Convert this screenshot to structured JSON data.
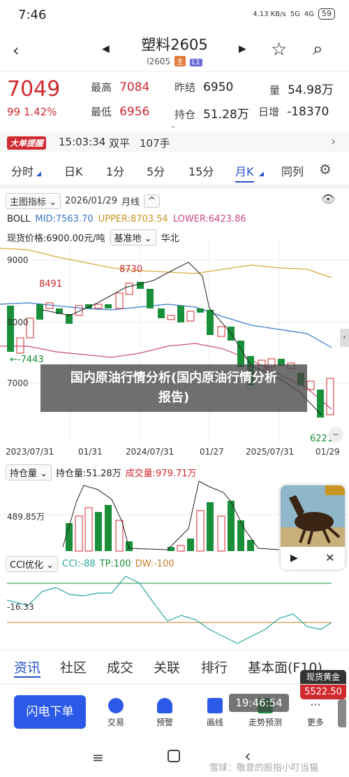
{
  "status": {
    "time": "7:46",
    "speed": "4.13 KB/s",
    "network": "5G",
    "network2": "4G",
    "battery": "59"
  },
  "header": {
    "title": "塑料2605",
    "code": "l2605",
    "tag_main": "主",
    "tag_l1": "L1"
  },
  "quote": {
    "price": "7049",
    "change": "99",
    "change_pct": "1.42%",
    "high_label": "最高",
    "high": "7084",
    "low_label": "最低",
    "low": "6956",
    "prev_label": "昨结",
    "prev": "6950",
    "oi_label": "持仓",
    "oi": "51.28万",
    "vol_label": "量",
    "vol": "54.98万",
    "daily_label": "日增",
    "daily": "-18370"
  },
  "ticker": {
    "badge": "大单提醒",
    "time": "15:03:34",
    "type": "双平",
    "qty": "107手"
  },
  "tabs": [
    "分时",
    "日K",
    "1分",
    "5分",
    "15分",
    "月K",
    "同列"
  ],
  "indicator": {
    "main_label": "主图指标",
    "date": "2026/01/29",
    "period": "月线"
  },
  "boll": {
    "name": "BOLL",
    "mid": "MID:7563.70",
    "upper": "UPPER:8703.54",
    "lower": "LOWER:6423.86"
  },
  "spot": {
    "label": "现货价格:6900.00元/吨",
    "basis": "基准地",
    "region": "华北"
  },
  "axis": {
    "y1": "9000",
    "y2": "8000",
    "y3": "7000",
    "mark_high": "8730",
    "mark_8491": "8491",
    "mark_7443": "7443",
    "mark_low": "6221"
  },
  "dates": [
    "2023/07/31",
    "01/31",
    "2024/07/31",
    "01/27",
    "2025/07/31",
    "01/29"
  ],
  "oi_panel": {
    "label": "持仓量",
    "oi": "持仓量:51.28万",
    "vol": "成交量:979.71万",
    "axis": "489.85万"
  },
  "cci_panel": {
    "label": "CCI优化",
    "cci": "CCI:-88",
    "tp": "TP:100",
    "dw": "DW:-100",
    "axis": "-16.33"
  },
  "banner": {
    "line1": "国内原油行情分析(国内原油行情分析",
    "line2": "报告)"
  },
  "bottom_tabs": [
    "资讯",
    "社区",
    "成交",
    "关联",
    "排行",
    "基本面(F10)"
  ],
  "actions": {
    "flash": "闪电下单",
    "trade": "交易",
    "alert": "预警",
    "draw": "画线",
    "trend": "走势预测",
    "more": "更多"
  },
  "gold": {
    "label": "现货黄金",
    "price": "5522.50"
  },
  "toast": "19:46:54",
  "watermark": "雪球：敬意的股指小叮当猫",
  "colors": {
    "red": "#d0292f",
    "green": "#1a8f3a",
    "blue": "#2750c8",
    "mid": "#3a78c9",
    "upper": "#d8a83a",
    "lower": "#c94b86"
  }
}
